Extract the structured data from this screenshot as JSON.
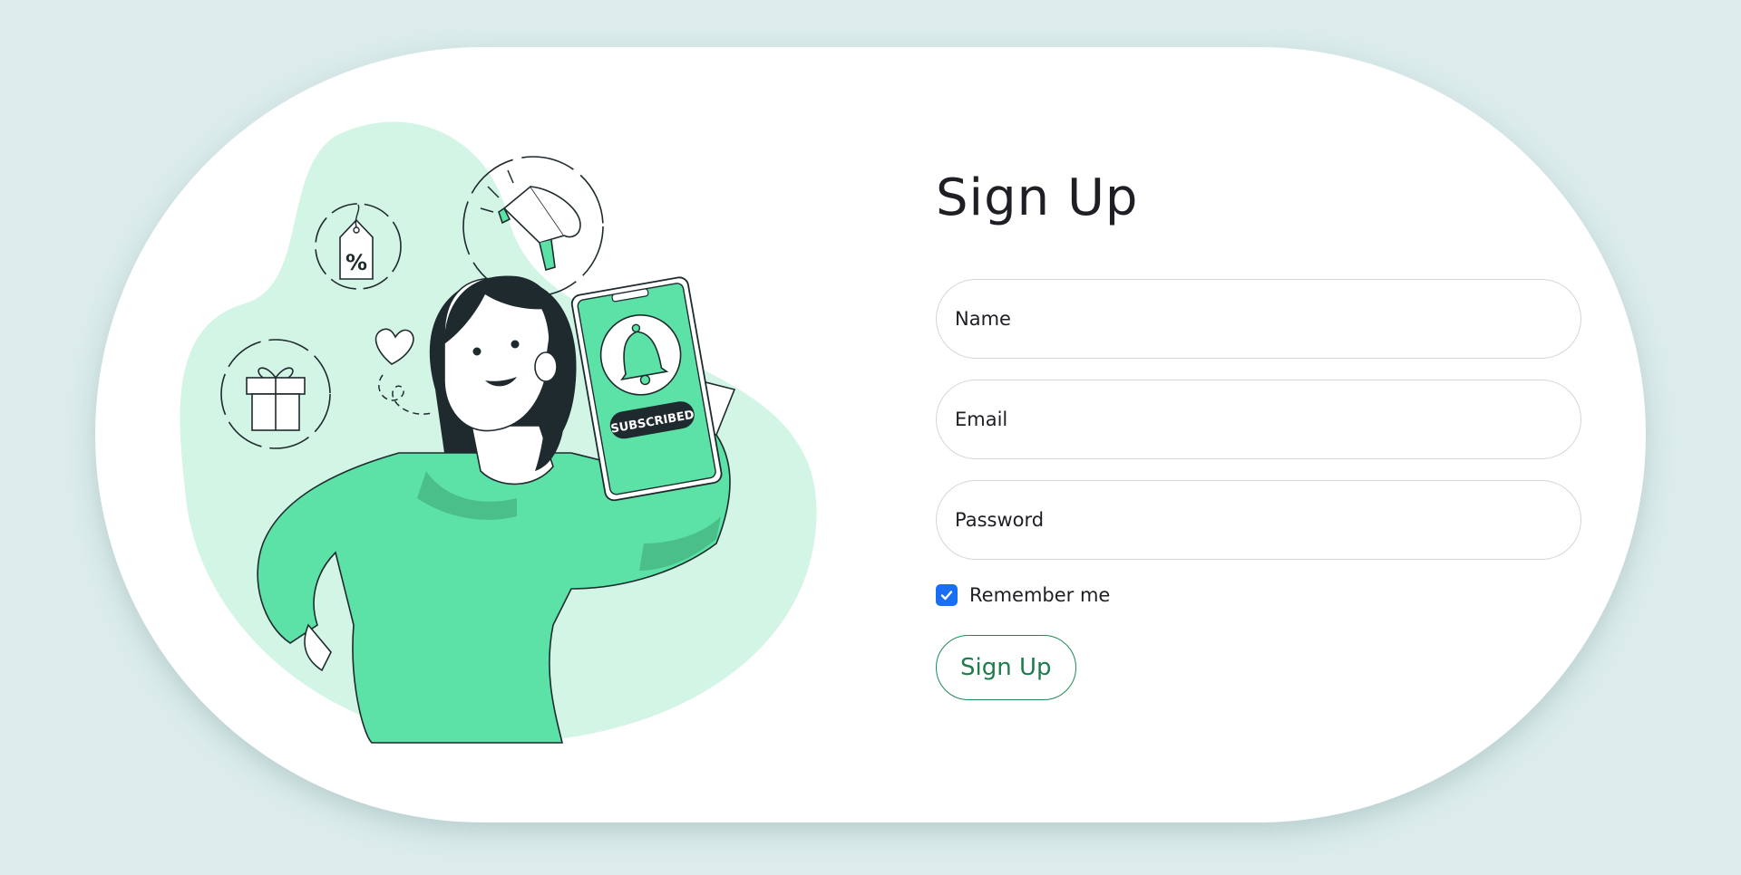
{
  "form": {
    "title": "Sign Up",
    "name_placeholder": "Name",
    "email_placeholder": "Email",
    "password_placeholder": "Password",
    "remember_label": "Remember me",
    "remember_checked": true,
    "submit_label": "Sign Up"
  },
  "illustration": {
    "phone_badge_text": "SUBSCRIBED",
    "tag_symbol": "%",
    "icons": [
      "percent-tag-icon",
      "megaphone-icon",
      "gift-icon",
      "heart-icon",
      "bell-icon"
    ]
  },
  "colors": {
    "background": "#dcecec",
    "card": "#ffffff",
    "accent_green": "#5ce1a6",
    "blob_green": "#d3f5e6",
    "checkbox_blue": "#1a6ef5",
    "button_green": "#1e7d4c"
  }
}
